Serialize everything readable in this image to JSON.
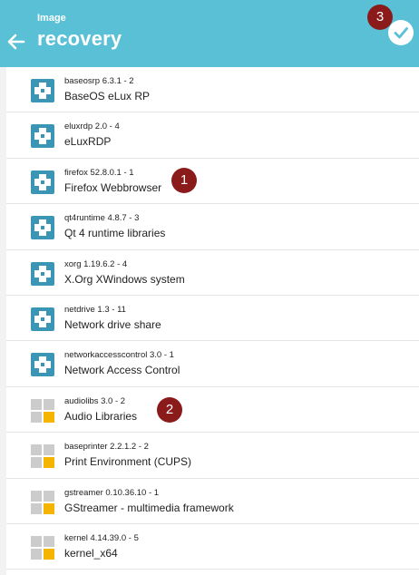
{
  "header": {
    "eyebrow": "Image",
    "title": "recovery",
    "back_icon": "arrow-left-icon",
    "confirm_icon": "check-circle-icon"
  },
  "colors": {
    "header_bg": "#5ac0d6",
    "installed_icon": "#3a96b4",
    "available_icon_gray": "#cccccc",
    "available_icon_yellow": "#f4b400",
    "badge": "#8b1a1a"
  },
  "packages": [
    {
      "meta": "baseosrp 6.3.1 - 2",
      "name": "BaseOS eLux RP",
      "state": "installed"
    },
    {
      "meta": "eluxrdp 2.0 - 4",
      "name": "eLuxRDP",
      "state": "installed"
    },
    {
      "meta": "firefox 52.8.0.1 - 1",
      "name": "Firefox Webbrowser",
      "state": "installed"
    },
    {
      "meta": "qt4runtime 4.8.7 - 3",
      "name": "Qt 4 runtime libraries",
      "state": "installed"
    },
    {
      "meta": "xorg 1.19.6.2 - 4",
      "name": "X.Org XWindows system",
      "state": "installed"
    },
    {
      "meta": "netdrive 1.3 - 11",
      "name": "Network drive share",
      "state": "installed"
    },
    {
      "meta": "networkaccesscontrol 3.0 - 1",
      "name": "Network Access Control",
      "state": "installed"
    },
    {
      "meta": "audiolibs 3.0 - 2",
      "name": "Audio Libraries",
      "state": "available"
    },
    {
      "meta": "baseprinter 2.2.1.2 - 2",
      "name": "Print Environment (CUPS)",
      "state": "available"
    },
    {
      "meta": "gstreamer 0.10.36.10 - 1",
      "name": "GStreamer - multimedia framework",
      "state": "available"
    },
    {
      "meta": "kernel 4.14.39.0 - 5",
      "name": "kernel_x64",
      "state": "available"
    }
  ],
  "badges": {
    "b1": "1",
    "b2": "2",
    "b3": "3"
  }
}
